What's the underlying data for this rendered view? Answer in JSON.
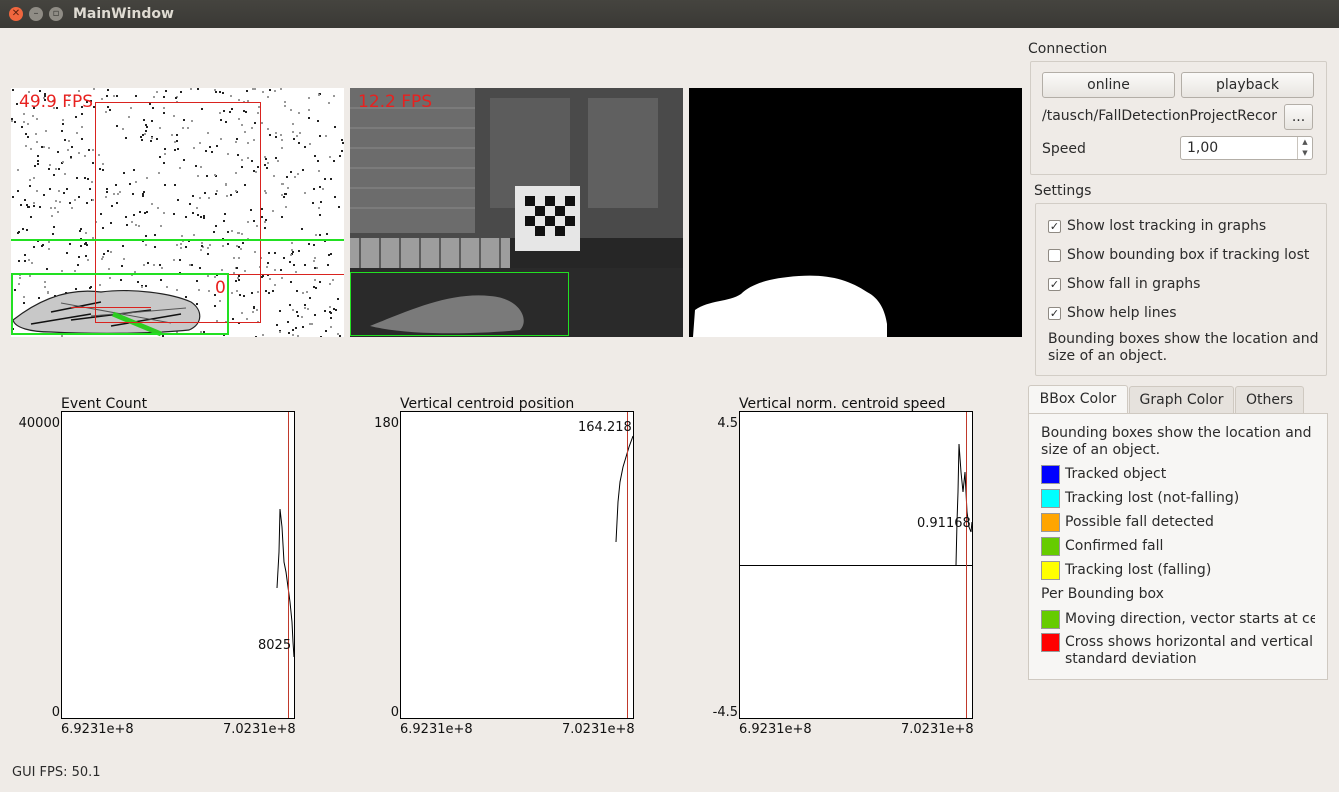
{
  "window": {
    "title": "MainWindow"
  },
  "views": {
    "event_fps": "49.9 FPS",
    "camera_fps": "12.2 FPS",
    "event_label": "0"
  },
  "graphs": [
    {
      "title": "Event Count",
      "ymax": "40000",
      "ymin": "0",
      "xmin": "6.9231e+8",
      "xmax": "7.0231e+8",
      "value": "8025"
    },
    {
      "title": "Vertical centroid position",
      "ymax": "180",
      "ymin": "0",
      "xmin": "6.9231e+8",
      "xmax": "7.0231e+8",
      "value": "164.218"
    },
    {
      "title": "Vertical norm. centroid speed",
      "ymax": "4.5",
      "ymin": "-4.5",
      "xmin": "6.9231e+8",
      "xmax": "7.0231e+8",
      "value": "0.91168"
    }
  ],
  "status": {
    "gui_fps": "GUI FPS: 50.1"
  },
  "connection": {
    "title": "Connection",
    "online_label": "online",
    "playback_label": "playback",
    "path": "/tausch/FallDetectionProjectRecor",
    "browse_label": "...",
    "speed_label": "Speed",
    "speed_value": "1,00"
  },
  "settings": {
    "title": "Settings",
    "options": [
      {
        "label": "Show lost tracking in graphs",
        "checked": true
      },
      {
        "label": "Show bounding box if tracking lost",
        "checked": false
      },
      {
        "label": "Show fall in graphs",
        "checked": true
      },
      {
        "label": "Show help lines",
        "checked": true
      }
    ],
    "note": "Bounding boxes show the location and size of an object."
  },
  "tabs": [
    {
      "label": "BBox Color",
      "active": true
    },
    {
      "label": "Graph Color",
      "active": false
    },
    {
      "label": "Others",
      "active": false
    }
  ],
  "bbox_colors": {
    "intro": "Bounding boxes show the location and size of an object.",
    "items": [
      {
        "label": "Tracked object",
        "color": "#0000ff"
      },
      {
        "label": "Tracking lost (not-falling)",
        "color": "#00ffff"
      },
      {
        "label": "Possible fall detected",
        "color": "#ffa500"
      },
      {
        "label": "Confirmed fall",
        "color": "#66cc00"
      },
      {
        "label": "Tracking lost (falling)",
        "color": "#ffff00"
      }
    ],
    "per_box_heading": "Per Bounding box",
    "per_box": [
      {
        "label": "Moving direction, vector starts at cen",
        "color": "#66cc00"
      },
      {
        "label": "Cross shows horizontal and vertical standard deviation",
        "color": "#ff0000"
      }
    ]
  }
}
